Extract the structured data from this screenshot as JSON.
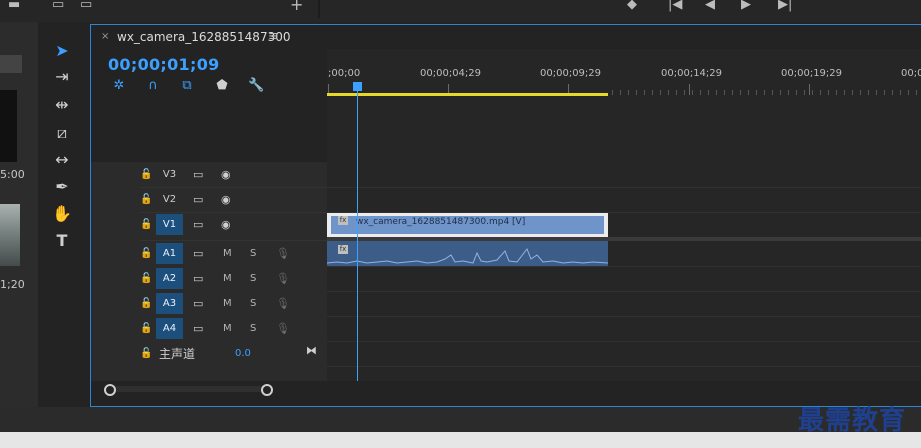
{
  "sequence": {
    "tab_title": "wx_camera_1628851487300",
    "tab_close": "×",
    "tab_menu": "≡",
    "timecode": "00;00;01;09"
  },
  "left_panel": {
    "time_a": "5:00",
    "time_b": "1;20"
  },
  "ruler": {
    "ticks": [
      ";00;00",
      "00;00;04;29",
      "00;00;09;29",
      "00;00;14;29",
      "00;00;19;29",
      "00;0"
    ]
  },
  "tracks": {
    "video": [
      {
        "label": "V3",
        "active": false
      },
      {
        "label": "V2",
        "active": false
      },
      {
        "label": "V1",
        "active": true
      }
    ],
    "audio": [
      {
        "label": "A1",
        "mute": "M",
        "solo": "S"
      },
      {
        "label": "A2",
        "mute": "M",
        "solo": "S"
      },
      {
        "label": "A3",
        "mute": "M",
        "solo": "S"
      },
      {
        "label": "A4",
        "mute": "M",
        "solo": "S"
      }
    ],
    "master": {
      "label": "主声道",
      "value": "0.0"
    }
  },
  "clips": {
    "video_clip_name": "wx_camera_1628851487300.mp4 [V]",
    "fx_badge": "fx"
  },
  "watermark": "最需教育",
  "colors": {
    "accent": "#3ba0ff",
    "work_area": "#e6d82a",
    "video_clip": "#6f94c9",
    "audio_clip": "#3d5d89"
  }
}
